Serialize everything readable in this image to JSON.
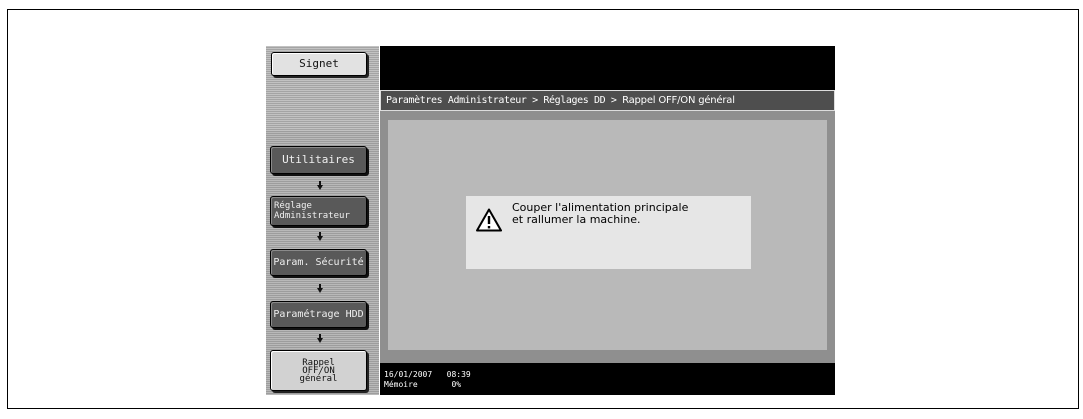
{
  "sidebar": {
    "bookmark_label": "Signet",
    "steps": [
      {
        "label": "Utilitaires"
      },
      {
        "label": "Réglage\nAdministrateur"
      },
      {
        "label": "Param. Sécurité"
      },
      {
        "label": "Paramétrage HDD"
      },
      {
        "label": "Rappel\nOFF/ON\ngénéral"
      }
    ],
    "arrow_icon": "down-arrow-icon"
  },
  "breadcrumb": {
    "part1": "Paramètres Administrateur > Réglages DD > ",
    "part2": "Rappel OFF/ON général"
  },
  "message": {
    "icon": "warning-icon",
    "line1": "Couper l'alimentation principale",
    "line2": "et rallumer la machine."
  },
  "status": {
    "date": "16/01/2007",
    "time": "08:39",
    "memory_label": "Mémoire",
    "memory_value": "0%"
  }
}
